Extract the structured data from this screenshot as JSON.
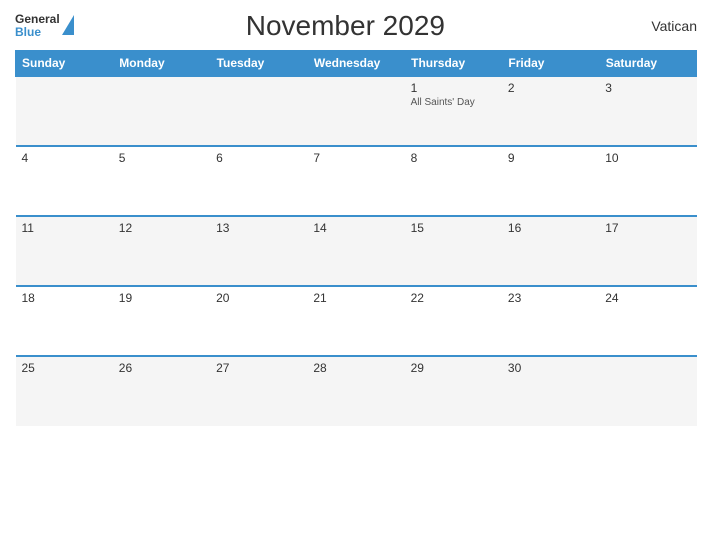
{
  "header": {
    "title": "November 2029",
    "country": "Vatican",
    "logo": {
      "general": "General",
      "blue": "Blue"
    }
  },
  "days_of_week": [
    "Sunday",
    "Monday",
    "Tuesday",
    "Wednesday",
    "Thursday",
    "Friday",
    "Saturday"
  ],
  "weeks": [
    [
      {
        "day": "",
        "holiday": ""
      },
      {
        "day": "",
        "holiday": ""
      },
      {
        "day": "",
        "holiday": ""
      },
      {
        "day": "",
        "holiday": ""
      },
      {
        "day": "1",
        "holiday": "All Saints' Day"
      },
      {
        "day": "2",
        "holiday": ""
      },
      {
        "day": "3",
        "holiday": ""
      }
    ],
    [
      {
        "day": "4",
        "holiday": ""
      },
      {
        "day": "5",
        "holiday": ""
      },
      {
        "day": "6",
        "holiday": ""
      },
      {
        "day": "7",
        "holiday": ""
      },
      {
        "day": "8",
        "holiday": ""
      },
      {
        "day": "9",
        "holiday": ""
      },
      {
        "day": "10",
        "holiday": ""
      }
    ],
    [
      {
        "day": "11",
        "holiday": ""
      },
      {
        "day": "12",
        "holiday": ""
      },
      {
        "day": "13",
        "holiday": ""
      },
      {
        "day": "14",
        "holiday": ""
      },
      {
        "day": "15",
        "holiday": ""
      },
      {
        "day": "16",
        "holiday": ""
      },
      {
        "day": "17",
        "holiday": ""
      }
    ],
    [
      {
        "day": "18",
        "holiday": ""
      },
      {
        "day": "19",
        "holiday": ""
      },
      {
        "day": "20",
        "holiday": ""
      },
      {
        "day": "21",
        "holiday": ""
      },
      {
        "day": "22",
        "holiday": ""
      },
      {
        "day": "23",
        "holiday": ""
      },
      {
        "day": "24",
        "holiday": ""
      }
    ],
    [
      {
        "day": "25",
        "holiday": ""
      },
      {
        "day": "26",
        "holiday": ""
      },
      {
        "day": "27",
        "holiday": ""
      },
      {
        "day": "28",
        "holiday": ""
      },
      {
        "day": "29",
        "holiday": ""
      },
      {
        "day": "30",
        "holiday": ""
      },
      {
        "day": "",
        "holiday": ""
      }
    ]
  ]
}
